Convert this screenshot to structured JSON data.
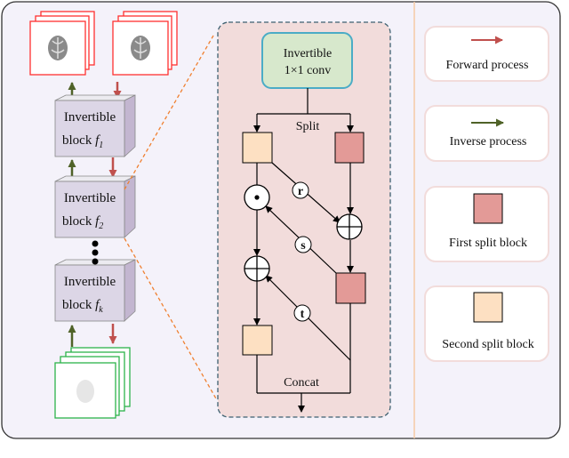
{
  "pipeline": {
    "blocks": [
      {
        "line1": "Invertible",
        "line2": "block",
        "fn": "f",
        "sub": "1"
      },
      {
        "line1": "Invertible",
        "line2": "block",
        "fn": "f",
        "sub": "2"
      },
      {
        "line1": "Invertible",
        "line2": "block",
        "fn": "f",
        "sub": "k"
      }
    ]
  },
  "detail": {
    "conv_line1": "Invertible",
    "conv_line2": "1×1 conv",
    "split_label": "Split",
    "concat_label": "Concat",
    "op_r": "r",
    "op_s": "s",
    "op_t": "t"
  },
  "legend": {
    "forward": "Forward process",
    "inverse": "Inverse process",
    "first_split": "First split block",
    "second_split": "Second split block"
  },
  "colors": {
    "forward_arrow": "#c0504d",
    "inverse_arrow": "#4f6228",
    "first_split_block": "#e39a97",
    "second_split_block": "#fde0c2",
    "conv_fill": "#d7e8cc",
    "conv_border": "#4bacc6",
    "detail_bg": "#f2dcdb",
    "panel_bg": "#f4f2fa",
    "block_face": "#dcd6e6"
  }
}
